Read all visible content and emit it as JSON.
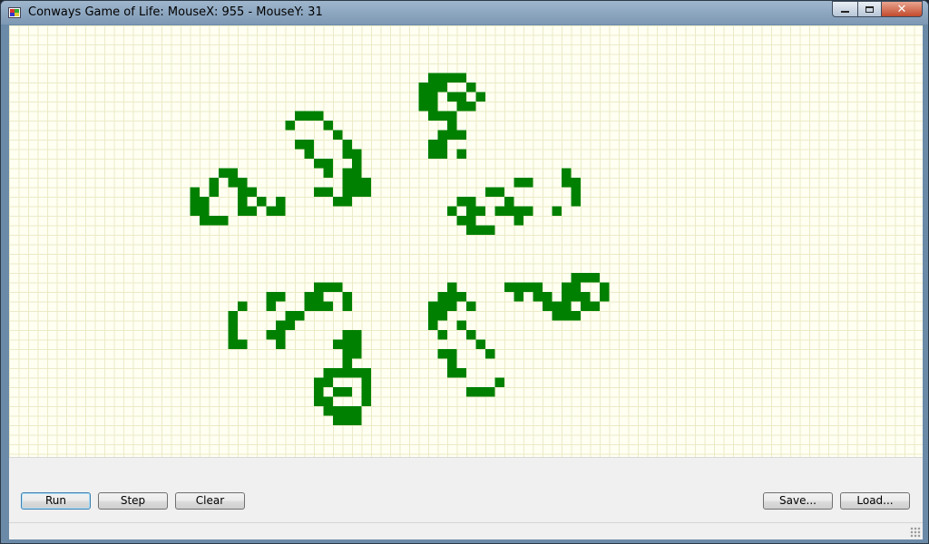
{
  "window": {
    "title": "Conways Game of Life: MouseX: 955 - MouseY: 31",
    "controls": {
      "minimize": "minimize",
      "maximize": "maximize",
      "close": "✕"
    }
  },
  "board": {
    "cell_color": "#008000",
    "grid_color": "#ebebc8",
    "background": "#fffff2",
    "live_cells": [
      [
        44,
        5
      ],
      [
        45,
        5
      ],
      [
        46,
        5
      ],
      [
        47,
        5
      ],
      [
        43,
        6
      ],
      [
        44,
        6
      ],
      [
        45,
        6
      ],
      [
        48,
        6
      ],
      [
        43,
        7
      ],
      [
        44,
        7
      ],
      [
        46,
        7
      ],
      [
        47,
        7
      ],
      [
        49,
        7
      ],
      [
        43,
        8
      ],
      [
        44,
        8
      ],
      [
        47,
        8
      ],
      [
        48,
        8
      ],
      [
        44,
        9
      ],
      [
        45,
        9
      ],
      [
        46,
        9
      ],
      [
        46,
        10
      ],
      [
        45,
        11
      ],
      [
        46,
        11
      ],
      [
        47,
        11
      ],
      [
        44,
        12
      ],
      [
        45,
        12
      ],
      [
        44,
        13
      ],
      [
        45,
        13
      ],
      [
        47,
        13
      ],
      [
        30,
        9
      ],
      [
        31,
        9
      ],
      [
        32,
        9
      ],
      [
        29,
        10
      ],
      [
        33,
        10
      ],
      [
        34,
        11
      ],
      [
        30,
        12
      ],
      [
        31,
        12
      ],
      [
        35,
        12
      ],
      [
        31,
        13
      ],
      [
        35,
        13
      ],
      [
        36,
        13
      ],
      [
        32,
        14
      ],
      [
        33,
        14
      ],
      [
        36,
        14
      ],
      [
        33,
        15
      ],
      [
        35,
        15
      ],
      [
        36,
        15
      ],
      [
        35,
        16
      ],
      [
        36,
        16
      ],
      [
        37,
        16
      ],
      [
        32,
        17
      ],
      [
        33,
        17
      ],
      [
        35,
        17
      ],
      [
        36,
        17
      ],
      [
        37,
        17
      ],
      [
        34,
        18
      ],
      [
        35,
        18
      ],
      [
        22,
        15
      ],
      [
        23,
        15
      ],
      [
        21,
        16
      ],
      [
        23,
        16
      ],
      [
        24,
        16
      ],
      [
        19,
        17
      ],
      [
        21,
        17
      ],
      [
        24,
        17
      ],
      [
        25,
        17
      ],
      [
        19,
        18
      ],
      [
        20,
        18
      ],
      [
        24,
        18
      ],
      [
        26,
        18
      ],
      [
        28,
        18
      ],
      [
        19,
        19
      ],
      [
        20,
        19
      ],
      [
        24,
        19
      ],
      [
        25,
        19
      ],
      [
        27,
        19
      ],
      [
        28,
        19
      ],
      [
        20,
        20
      ],
      [
        21,
        20
      ],
      [
        22,
        20
      ],
      [
        58,
        15
      ],
      [
        58,
        16
      ],
      [
        59,
        16
      ],
      [
        53,
        16
      ],
      [
        54,
        16
      ],
      [
        59,
        17
      ],
      [
        50,
        17
      ],
      [
        51,
        17
      ],
      [
        47,
        18
      ],
      [
        48,
        18
      ],
      [
        52,
        18
      ],
      [
        59,
        18
      ],
      [
        46,
        19
      ],
      [
        48,
        19
      ],
      [
        49,
        19
      ],
      [
        51,
        19
      ],
      [
        52,
        19
      ],
      [
        53,
        19
      ],
      [
        54,
        19
      ],
      [
        57,
        19
      ],
      [
        47,
        20
      ],
      [
        48,
        20
      ],
      [
        53,
        20
      ],
      [
        48,
        21
      ],
      [
        49,
        21
      ],
      [
        50,
        21
      ],
      [
        32,
        27
      ],
      [
        33,
        27
      ],
      [
        34,
        27
      ],
      [
        27,
        28
      ],
      [
        28,
        28
      ],
      [
        31,
        28
      ],
      [
        32,
        28
      ],
      [
        35,
        28
      ],
      [
        24,
        29
      ],
      [
        27,
        29
      ],
      [
        31,
        29
      ],
      [
        32,
        29
      ],
      [
        33,
        29
      ],
      [
        35,
        29
      ],
      [
        23,
        30
      ],
      [
        29,
        30
      ],
      [
        30,
        30
      ],
      [
        23,
        31
      ],
      [
        28,
        31
      ],
      [
        29,
        31
      ],
      [
        23,
        32
      ],
      [
        27,
        32
      ],
      [
        28,
        32
      ],
      [
        28,
        33
      ],
      [
        23,
        33
      ],
      [
        24,
        33
      ],
      [
        59,
        26
      ],
      [
        60,
        26
      ],
      [
        61,
        26
      ],
      [
        52,
        27
      ],
      [
        53,
        27
      ],
      [
        54,
        27
      ],
      [
        55,
        27
      ],
      [
        58,
        27
      ],
      [
        59,
        27
      ],
      [
        62,
        27
      ],
      [
        53,
        28
      ],
      [
        55,
        28
      ],
      [
        56,
        28
      ],
      [
        58,
        28
      ],
      [
        59,
        28
      ],
      [
        60,
        28
      ],
      [
        62,
        28
      ],
      [
        56,
        29
      ],
      [
        57,
        29
      ],
      [
        58,
        29
      ],
      [
        60,
        29
      ],
      [
        61,
        29
      ],
      [
        57,
        30
      ],
      [
        58,
        30
      ],
      [
        59,
        30
      ],
      [
        46,
        27
      ],
      [
        45,
        28
      ],
      [
        46,
        28
      ],
      [
        47,
        28
      ],
      [
        44,
        29
      ],
      [
        45,
        29
      ],
      [
        46,
        29
      ],
      [
        48,
        29
      ],
      [
        44,
        30
      ],
      [
        45,
        30
      ],
      [
        44,
        31
      ],
      [
        47,
        31
      ],
      [
        45,
        32
      ],
      [
        48,
        32
      ],
      [
        49,
        33
      ],
      [
        45,
        34
      ],
      [
        46,
        34
      ],
      [
        50,
        34
      ],
      [
        46,
        35
      ],
      [
        46,
        36
      ],
      [
        47,
        36
      ],
      [
        51,
        37
      ],
      [
        48,
        38
      ],
      [
        49,
        38
      ],
      [
        50,
        38
      ],
      [
        35,
        32
      ],
      [
        36,
        32
      ],
      [
        34,
        33
      ],
      [
        35,
        33
      ],
      [
        36,
        33
      ],
      [
        35,
        34
      ],
      [
        36,
        34
      ],
      [
        35,
        35
      ],
      [
        33,
        36
      ],
      [
        34,
        36
      ],
      [
        35,
        36
      ],
      [
        36,
        36
      ],
      [
        37,
        36
      ],
      [
        32,
        37
      ],
      [
        33,
        37
      ],
      [
        37,
        37
      ],
      [
        32,
        38
      ],
      [
        34,
        38
      ],
      [
        35,
        38
      ],
      [
        37,
        38
      ],
      [
        33,
        39
      ],
      [
        37,
        39
      ],
      [
        32,
        39
      ],
      [
        33,
        40
      ],
      [
        34,
        40
      ],
      [
        35,
        40
      ],
      [
        36,
        40
      ],
      [
        34,
        41
      ],
      [
        35,
        41
      ],
      [
        36,
        41
      ]
    ]
  },
  "buttons": {
    "run": "Run",
    "step": "Step",
    "clear": "Clear",
    "save": "Save...",
    "load": "Load..."
  }
}
